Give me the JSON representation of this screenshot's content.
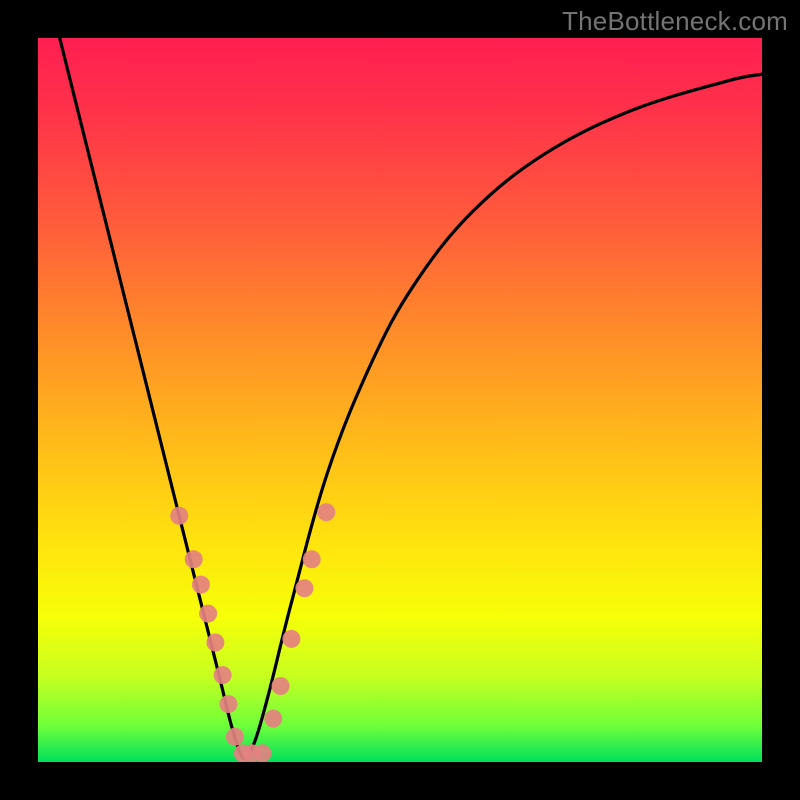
{
  "watermark": "TheBottleneck.com",
  "chart_data": {
    "type": "line",
    "title": "",
    "xlabel": "",
    "ylabel": "",
    "xlim": [
      0,
      100
    ],
    "ylim": [
      0,
      100
    ],
    "notes": "V-shaped bottleneck curve on a red→green vertical gradient. Pink dots cluster near the trough and lower arms of the V.",
    "series": [
      {
        "name": "bottleneck-curve",
        "x": [
          3,
          6,
          10,
          14,
          18,
          22,
          25,
          27,
          28.5,
          30,
          32,
          35,
          40,
          46,
          52,
          60,
          70,
          82,
          95,
          100
        ],
        "y": [
          100,
          88,
          72,
          56,
          40,
          24,
          12,
          4,
          0.5,
          3,
          10,
          22,
          40,
          55,
          66,
          76,
          84,
          90,
          94,
          95
        ]
      }
    ],
    "markers": [
      {
        "x": 19.5,
        "y": 34
      },
      {
        "x": 21.5,
        "y": 28
      },
      {
        "x": 22.5,
        "y": 24.5
      },
      {
        "x": 23.5,
        "y": 20.5
      },
      {
        "x": 24.5,
        "y": 16.5
      },
      {
        "x": 25.5,
        "y": 12
      },
      {
        "x": 26.3,
        "y": 8
      },
      {
        "x": 27.2,
        "y": 3.5
      },
      {
        "x": 28.3,
        "y": 1.2
      },
      {
        "x": 29.5,
        "y": 1.2
      },
      {
        "x": 31,
        "y": 1.2
      },
      {
        "x": 32.5,
        "y": 6
      },
      {
        "x": 33.5,
        "y": 10.5
      },
      {
        "x": 35,
        "y": 17
      },
      {
        "x": 36.8,
        "y": 24
      },
      {
        "x": 37.8,
        "y": 28
      },
      {
        "x": 39.8,
        "y": 34.5
      }
    ],
    "gradient_stops": [
      {
        "pos": 0,
        "color": "#ff1f52"
      },
      {
        "pos": 0.4,
        "color": "#ff8a2a"
      },
      {
        "pos": 0.7,
        "color": "#ffe40e"
      },
      {
        "pos": 0.95,
        "color": "#6fff3a"
      },
      {
        "pos": 1.0,
        "color": "#00e05c"
      }
    ]
  }
}
